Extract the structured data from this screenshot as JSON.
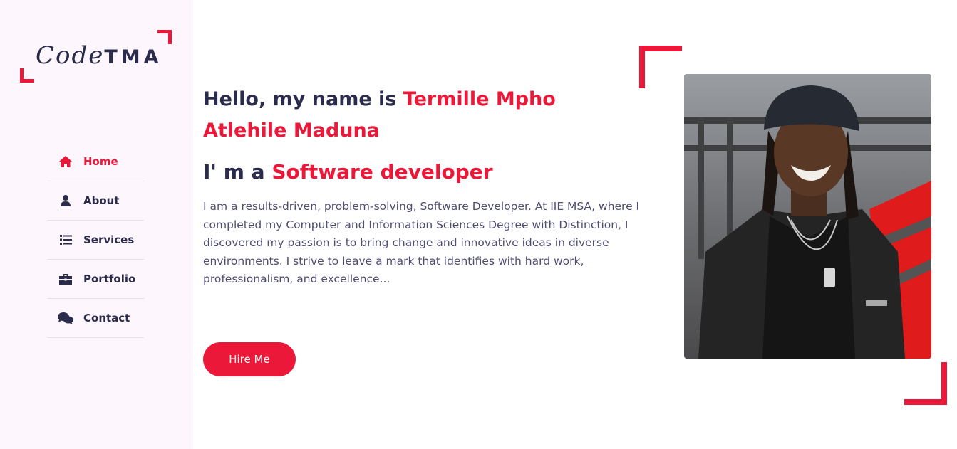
{
  "brand": {
    "script_part": "Code",
    "strong_part": "TMA",
    "accent_color": "#ec1839",
    "text_color": "#2b2c4b"
  },
  "nav": {
    "items": [
      {
        "label": "Home",
        "icon": "home-icon",
        "active": true
      },
      {
        "label": "About",
        "icon": "user-icon",
        "active": false
      },
      {
        "label": "Services",
        "icon": "list-icon",
        "active": false
      },
      {
        "label": "Portfolio",
        "icon": "briefcase-icon",
        "active": false
      },
      {
        "label": "Contact",
        "icon": "comments-icon",
        "active": false
      }
    ]
  },
  "hero": {
    "greeting_prefix": "Hello, my name is ",
    "name": "Termille Mpho Atlehile Maduna",
    "profession_prefix": "I' m a ",
    "profession": "Software developer",
    "description": "I am a results-driven, problem-solving, Software Developer. At IIE MSA, where I completed my Computer and Information Sciences Degree with Distinction, I discovered my passion is to bring change and innovative ideas in diverse environments. I strive to leave a mark that identifies with hard work, professionalism, and excellence...",
    "hire_button": "Hire Me"
  },
  "photo": {
    "subject": "profile-photo"
  }
}
